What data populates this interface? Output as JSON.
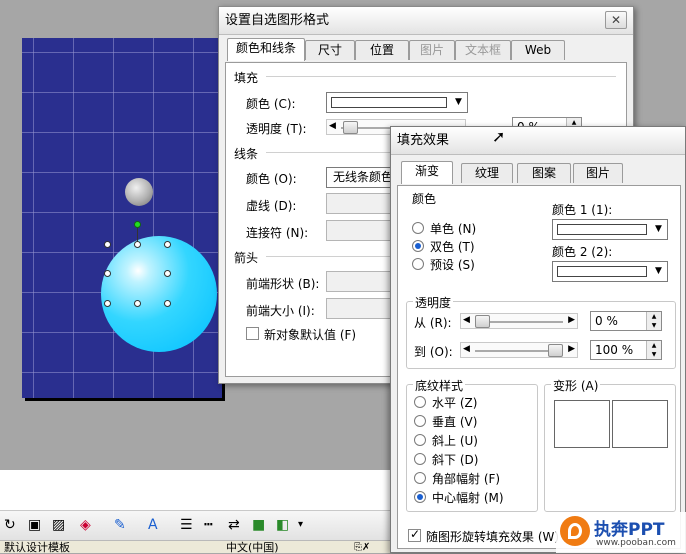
{
  "main_dialog": {
    "title": "设置自选图形格式",
    "close_label": "✕",
    "tabs": [
      {
        "label": "颜色和线条",
        "state": "active"
      },
      {
        "label": "尺寸",
        "state": "normal"
      },
      {
        "label": "位置",
        "state": "normal"
      },
      {
        "label": "图片",
        "state": "disabled"
      },
      {
        "label": "文本框",
        "state": "disabled"
      },
      {
        "label": "Web",
        "state": "normal"
      }
    ],
    "fill_section": {
      "title": "填充",
      "color_label": "颜色 (C):",
      "transparency_label": "透明度 (T):",
      "transparency_value": "0 %"
    },
    "line_section": {
      "title": "线条",
      "color_label": "颜色 (O):",
      "color_value": "无线条颜色",
      "dash_label": "虚线 (D):",
      "connector_label": "连接符 (N):"
    },
    "arrow_section": {
      "title": "箭头",
      "begin_style_label": "前端形状 (B):",
      "begin_size_label": "前端大小 (I):"
    },
    "default_checkbox_label": "新对象默认值 (F)"
  },
  "fill_dialog": {
    "title": "填充效果",
    "tabs": [
      {
        "label": "渐变",
        "state": "active"
      },
      {
        "label": "纹理",
        "state": "normal"
      },
      {
        "label": "图案",
        "state": "normal"
      },
      {
        "label": "图片",
        "state": "normal"
      }
    ],
    "colors": {
      "title": "颜色",
      "options": [
        {
          "label": "单色 (N)",
          "checked": false
        },
        {
          "label": "双色 (T)",
          "checked": true
        },
        {
          "label": "预设 (S)",
          "checked": false
        }
      ],
      "color1_label": "颜色 1 (1):",
      "color2_label": "颜色 2 (2):"
    },
    "transparency": {
      "title": "透明度",
      "from_label": "从 (R):",
      "from_value": "0 %",
      "to_label": "到 (O):",
      "to_value": "100 %",
      "from_fraction": 0.0,
      "to_fraction": 1.0
    },
    "shading": {
      "title": "底纹样式",
      "options": [
        {
          "label": "水平 (Z)",
          "checked": false
        },
        {
          "label": "垂直 (V)",
          "checked": false
        },
        {
          "label": "斜上 (U)",
          "checked": false
        },
        {
          "label": "斜下 (D)",
          "checked": false
        },
        {
          "label": "角部幅射 (F)",
          "checked": false
        },
        {
          "label": "中心幅射 (M)",
          "checked": true
        }
      ]
    },
    "variants_title": "变形 (A)",
    "rotate_checkbox_label": "随图形旋转填充效果 (W)"
  },
  "statusbar": {
    "template": "默认设计模板",
    "language": "中文(中国)"
  },
  "watermark": {
    "brand": "执奔PPT",
    "url": "www.pooban.com"
  },
  "colors": {
    "slide_bg": "#2a2f8f",
    "ball_cyan": "#00bfff",
    "accent_blue": "#1a5fd0",
    "watermark_orange": "#f07b12"
  }
}
